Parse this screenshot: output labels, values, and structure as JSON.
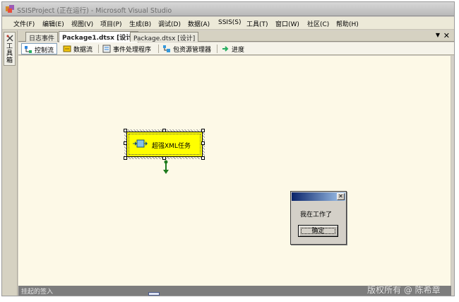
{
  "window": {
    "title": "SSISProject (正在运行) - Microsoft Visual Studio"
  },
  "menu": [
    "文件(F)",
    "编辑(E)",
    "视图(V)",
    "项目(P)",
    "生成(B)",
    "调试(D)",
    "数据(A)",
    "SSIS(S)",
    "工具(T)",
    "窗口(W)",
    "社区(C)",
    "帮助(H)"
  ],
  "toolbox": {
    "label": "工具箱"
  },
  "doc_tabs": [
    {
      "label": "日志事件",
      "active": false
    },
    {
      "label": "Package1.dtsx [设计]",
      "active": true
    },
    {
      "label": "Package.dtsx [设计]",
      "active": false
    }
  ],
  "designer_tabs": [
    {
      "label": "控制流",
      "icon": "control-flow-icon",
      "active": true
    },
    {
      "label": "数据流",
      "icon": "data-flow-icon",
      "active": false
    },
    {
      "label": "事件处理程序",
      "icon": "event-handler-icon",
      "active": false
    },
    {
      "label": "包资源管理器",
      "icon": "package-explorer-icon",
      "active": false
    },
    {
      "label": "进度",
      "icon": "progress-icon",
      "active": false
    }
  ],
  "task": {
    "label": "超强XML任务",
    "icon": "task-icon",
    "fill_color": "#ffff00"
  },
  "message_box": {
    "text": "我在工作了",
    "ok_label": "确定",
    "close_glyph": "✕"
  },
  "pending_bar": {
    "label": "挂起的签入"
  },
  "watermark": "版权所有 @ 陈希章",
  "colors": {
    "surface": "#fdf9e7",
    "task_fill": "#ffff00",
    "connector": "#1d7a1d",
    "msg_title_start": "#0a246a",
    "msg_title_end": "#a6caf0"
  }
}
